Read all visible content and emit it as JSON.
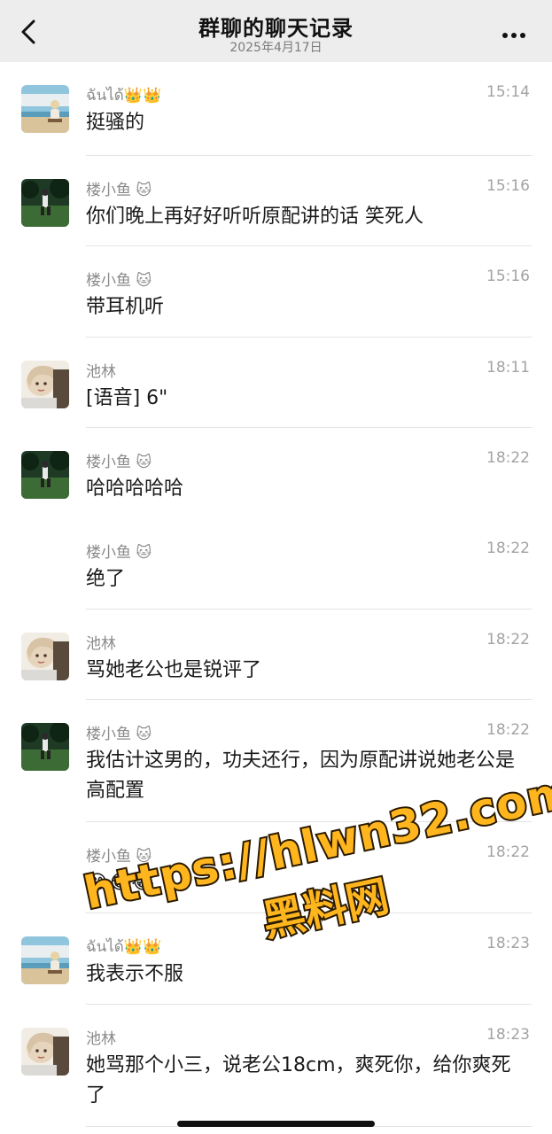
{
  "header": {
    "title": "群聊的聊天记录",
    "date": "2025年4月17日",
    "back_icon": "chevron-left-icon",
    "more_icon": "more-dots-icon"
  },
  "messages": [
    {
      "sender": "ฉันได้👑👑",
      "time": "15:14",
      "text": "挺骚的",
      "avatar": "beach-avatar"
    },
    {
      "sender": "楼小鱼 🐱",
      "time": "15:16",
      "text": "你们晚上再好好听听原配讲的话 笑死人",
      "avatar": "forest-avatar"
    },
    {
      "sender": "楼小鱼 🐱",
      "time": "15:16",
      "text": "带耳机听",
      "avatar": ""
    },
    {
      "sender": "池林",
      "time": "18:11",
      "text": "[语音] 6\"",
      "avatar": "girl-avatar"
    },
    {
      "sender": "楼小鱼 🐱",
      "time": "18:22",
      "text": "哈哈哈哈哈",
      "avatar": "forest-avatar"
    },
    {
      "sender": "楼小鱼 🐱",
      "time": "18:22",
      "text": "绝了",
      "avatar": ""
    },
    {
      "sender": "池林",
      "time": "18:22",
      "text": "骂她老公也是锐评了",
      "avatar": "girl-avatar"
    },
    {
      "sender": "楼小鱼 🐱",
      "time": "18:22",
      "text": "我估计这男的，功夫还行，因为原配讲说她老公是高配置",
      "avatar": "forest-avatar"
    },
    {
      "sender": "楼小鱼 🐱",
      "time": "18:22",
      "text": "😂😂😂",
      "avatar": ""
    },
    {
      "sender": "ฉันได้👑👑",
      "time": "18:23",
      "text": "我表示不服",
      "avatar": "beach-avatar"
    },
    {
      "sender": "池林",
      "time": "18:23",
      "text": "她骂那个小三，说老公18cm，爽死你，给你爽死了",
      "avatar": "girl-avatar"
    }
  ],
  "watermark": {
    "line1": "https://hlwn32.com",
    "line2": "黑料网"
  },
  "colors": {
    "header_bg": "#ededed",
    "separator": "#e3e3e3",
    "watermark_fill": "#ffb61e"
  }
}
